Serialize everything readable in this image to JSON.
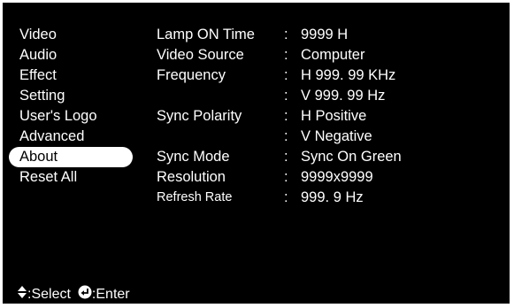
{
  "menu": {
    "items": [
      {
        "label": "Video"
      },
      {
        "label": "Audio"
      },
      {
        "label": "Effect"
      },
      {
        "label": "Setting"
      },
      {
        "label": "User's Logo"
      },
      {
        "label": "Advanced"
      },
      {
        "label": "About",
        "selected": true
      },
      {
        "label": "Reset All"
      }
    ]
  },
  "info": {
    "rows": [
      {
        "label": "Lamp ON Time",
        "colon": ":",
        "value": "9999 H"
      },
      {
        "label": "Video Source",
        "colon": ":",
        "value": "Computer"
      },
      {
        "label": "Frequency",
        "colon": ":",
        "value": "H 999. 99 KHz"
      },
      {
        "label": "",
        "colon": ":",
        "value": "V 999. 99 Hz"
      },
      {
        "label": "Sync Polarity",
        "colon": ":",
        "value": "H Positive"
      },
      {
        "label": "",
        "colon": ":",
        "value": "V Negative"
      },
      {
        "label": "Sync Mode",
        "colon": ":",
        "value": "Sync On Green"
      },
      {
        "label": "Resolution",
        "colon": ":",
        "value": "9999x9999"
      },
      {
        "label": "Refresh Rate",
        "colon": ":",
        "value": "999. 9 Hz"
      }
    ]
  },
  "footer": {
    "select_label": ":Select",
    "enter_label": ":Enter",
    "select_icon": "up-down-arrow-icon",
    "enter_icon": "enter-return-icon"
  },
  "colors": {
    "background": "#000000",
    "text": "#ffffff",
    "highlight": "#ffffff",
    "highlight_text": "#000000"
  }
}
